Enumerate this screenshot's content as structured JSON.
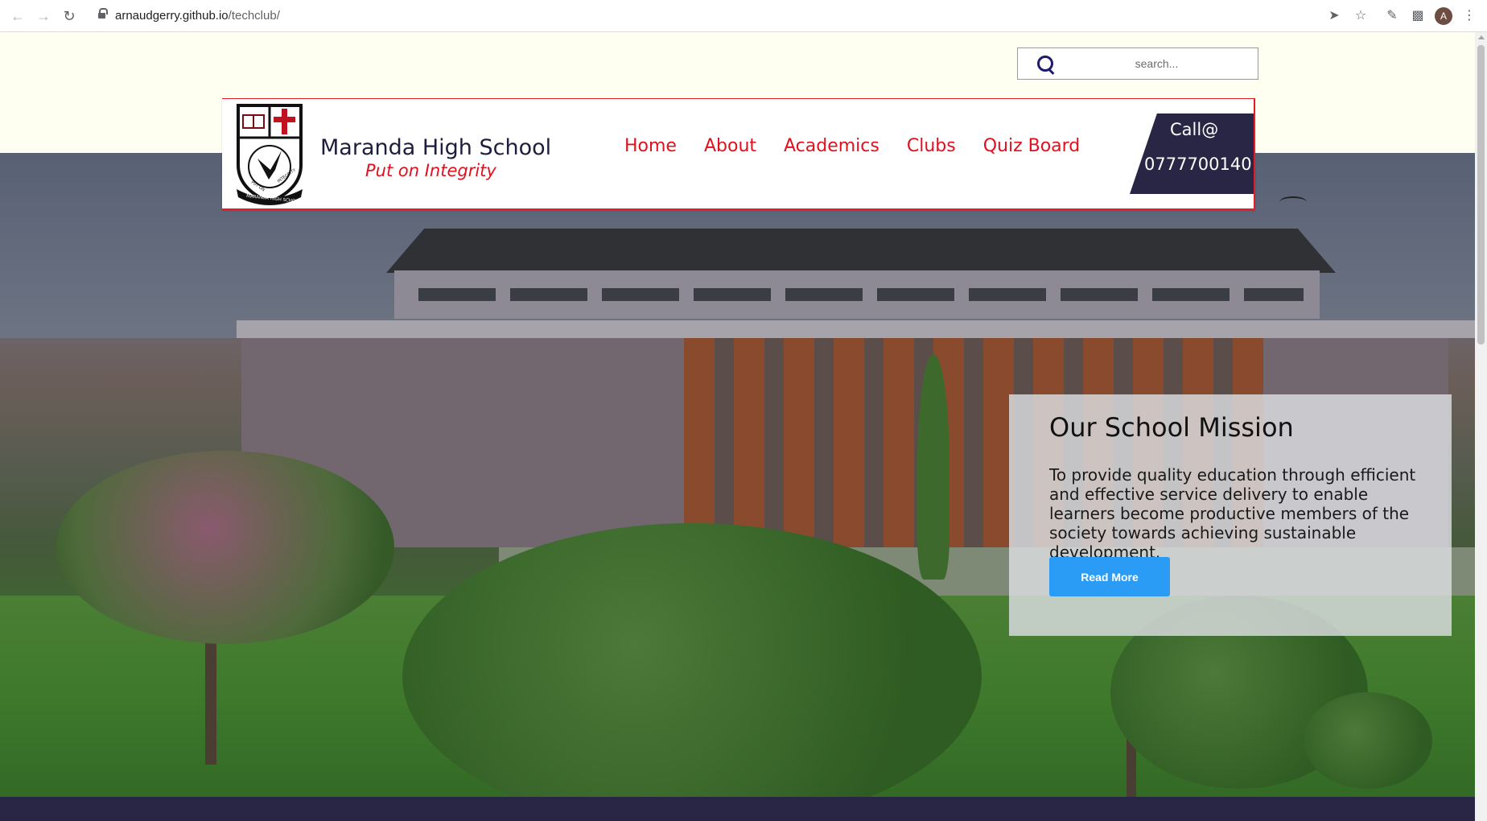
{
  "browser": {
    "url_host": "arnaudgerry.github.io",
    "url_path": "/techclub/",
    "profile_initial": "A",
    "icons": [
      "back-arrow",
      "forward-arrow",
      "reload",
      "lock",
      "send",
      "star",
      "extension-edit",
      "puzzle",
      "kebab-menu"
    ]
  },
  "search": {
    "placeholder": "search..."
  },
  "header": {
    "school_name": "Maranda High School",
    "motto": "Put on Integrity",
    "logo": {
      "top_text": "PUT ON INTEGRITY",
      "ribbon_text": "MARANDA HIGH SCHOOL"
    },
    "nav": [
      {
        "label": "Home"
      },
      {
        "label": "About"
      },
      {
        "label": "Academics"
      },
      {
        "label": "Clubs"
      },
      {
        "label": "Quiz Board"
      }
    ],
    "call": {
      "line1": "Call@",
      "line2": "0777700140"
    }
  },
  "mission": {
    "title": "Our School Mission",
    "text": "To provide quality education through efficient and effective service delivery to enable learners become productive members of the society towards achieving sustainable development.",
    "button_label": "Read More"
  },
  "colors": {
    "accent_red": "#e0101f",
    "navy": "#292545",
    "button_blue": "#2b9cf5",
    "top_strip": "#fefff0"
  }
}
